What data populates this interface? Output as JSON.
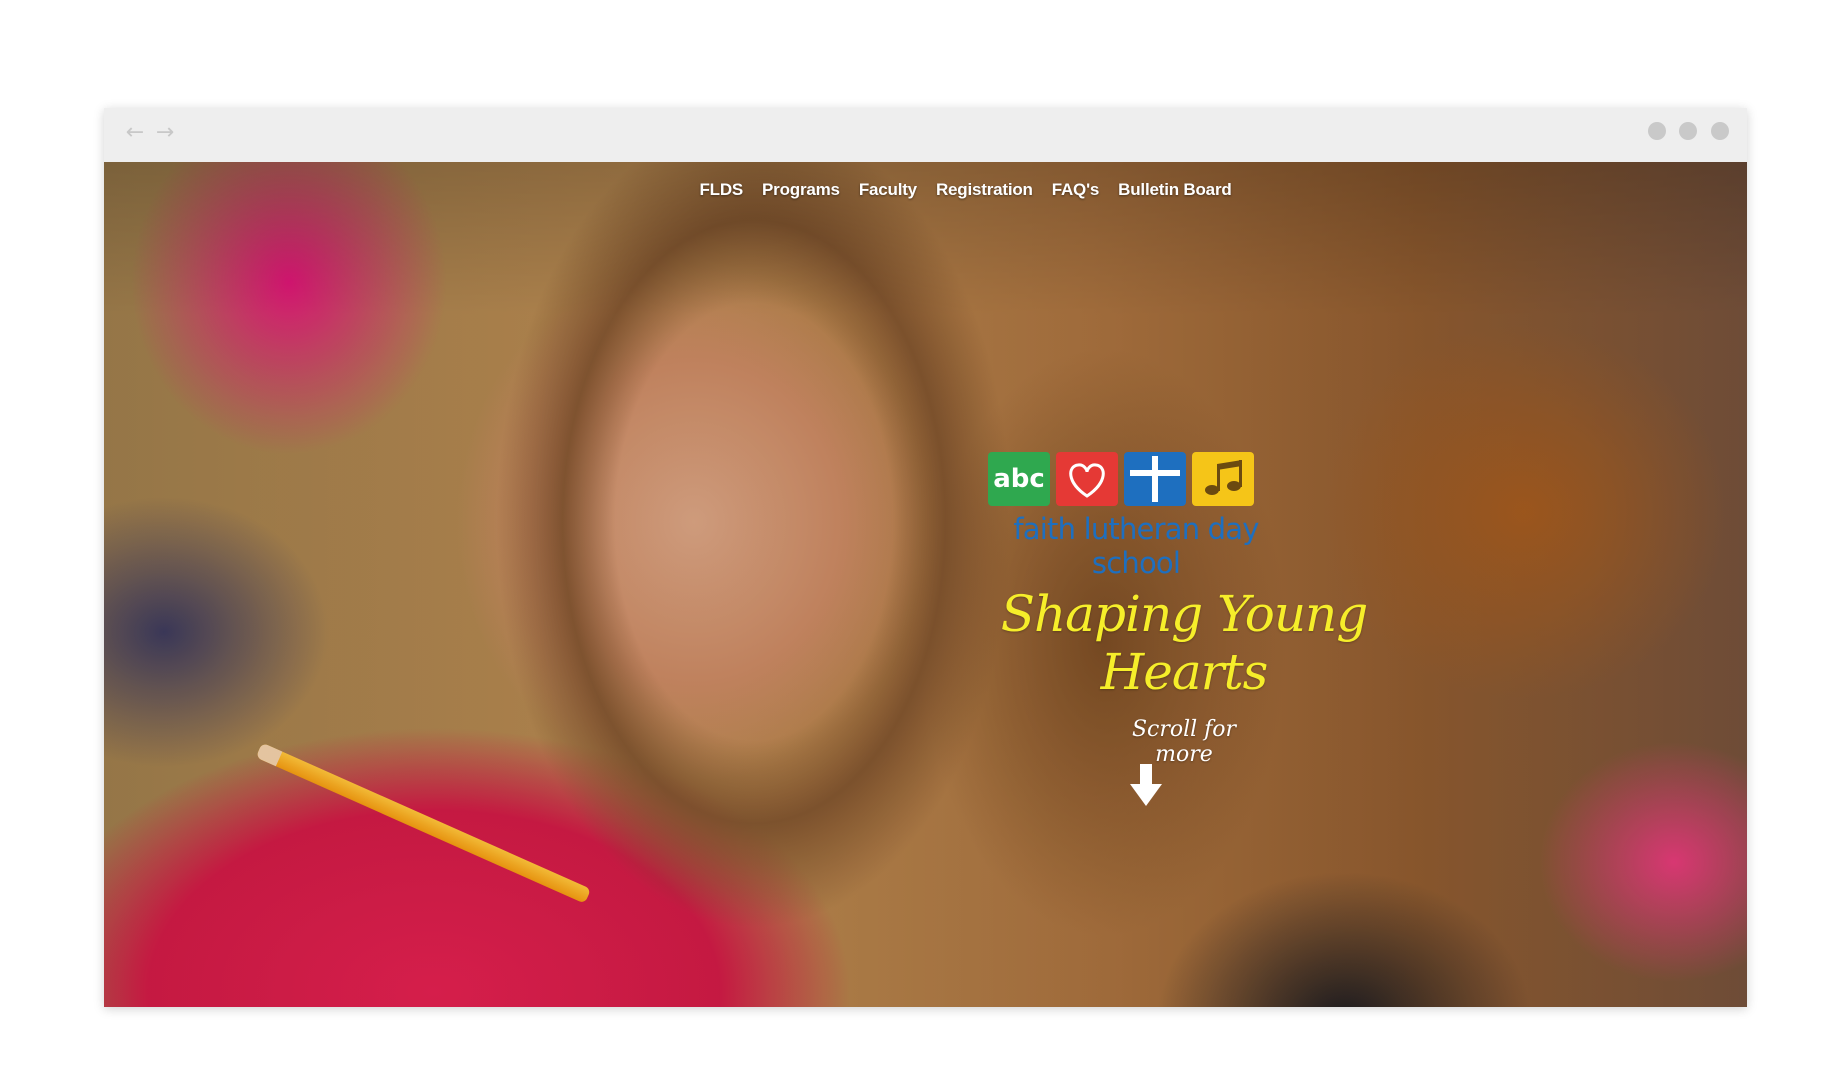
{
  "browser": {
    "back_icon": "←",
    "forward_icon": "→"
  },
  "nav": {
    "items": [
      "FLDS",
      "Programs",
      "Faculty",
      "Registration",
      "FAQ's",
      "Bulletin Board"
    ]
  },
  "logo": {
    "tiles": [
      {
        "icon": "abc-icon",
        "color": "#2fa84f"
      },
      {
        "icon": "heart-icon",
        "color": "#e53935"
      },
      {
        "icon": "cross-icon",
        "color": "#1e6fbf"
      },
      {
        "icon": "music-note-icon",
        "color": "#f5c518"
      }
    ],
    "tile_text": "abc",
    "school_name": "faith lutheran day school"
  },
  "hero": {
    "tagline": "Shaping Young Hearts",
    "scroll_text": "Scroll for more"
  }
}
